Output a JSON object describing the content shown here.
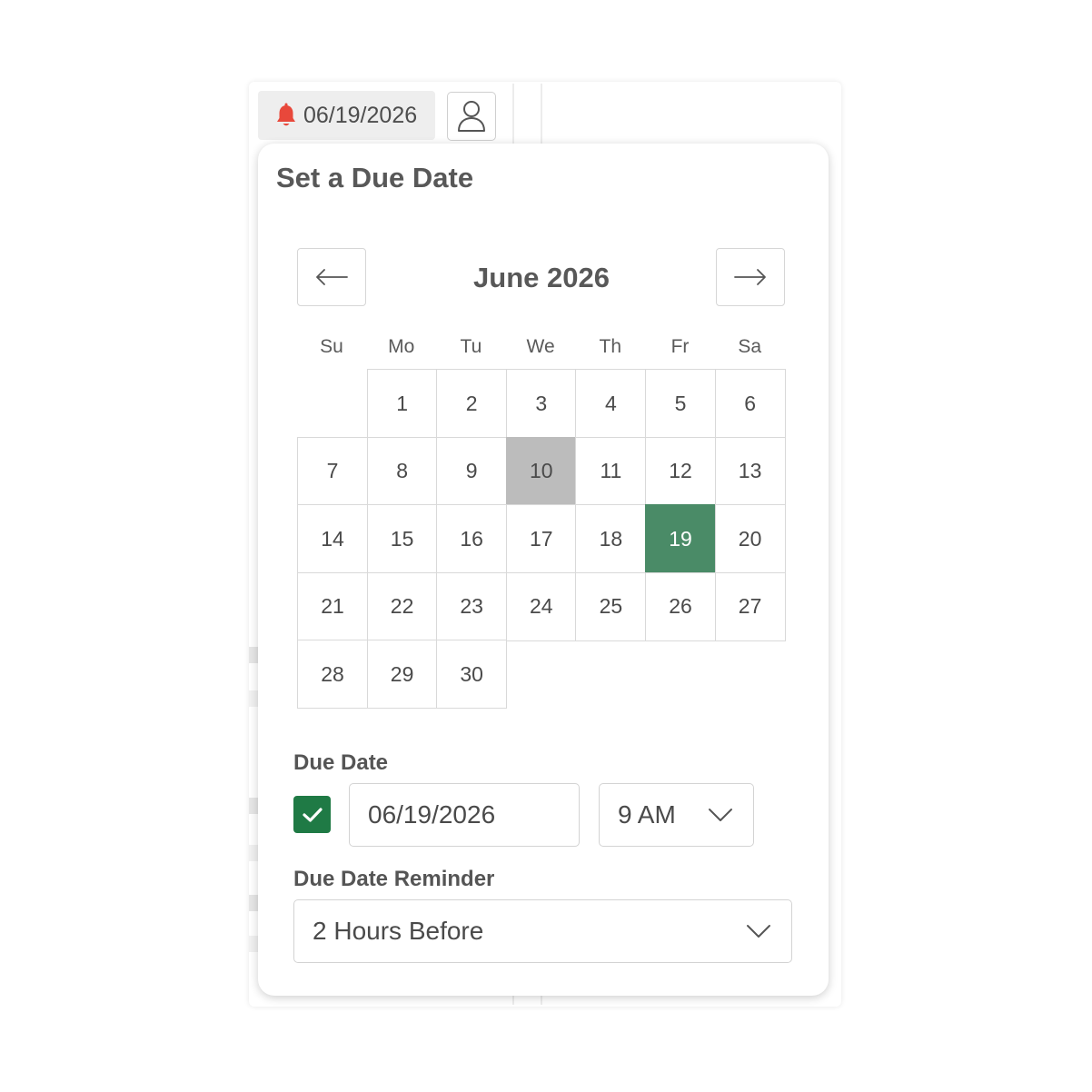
{
  "toolbar": {
    "due_chip_date": "06/19/2026",
    "bell_icon": "bell-icon",
    "assignee_icon": "person-icon"
  },
  "popover": {
    "title": "Set a Due Date",
    "calendar": {
      "month_label": "June 2026",
      "prev_icon": "arrow-left-icon",
      "next_icon": "arrow-right-icon",
      "weekdays": [
        "Su",
        "Mo",
        "Tu",
        "We",
        "Th",
        "Fr",
        "Sa"
      ],
      "leading_blank_days": 1,
      "days": [
        "1",
        "2",
        "3",
        "4",
        "5",
        "6",
        "7",
        "8",
        "9",
        "10",
        "11",
        "12",
        "13",
        "14",
        "15",
        "16",
        "17",
        "18",
        "19",
        "20",
        "21",
        "22",
        "23",
        "24",
        "25",
        "26",
        "27",
        "28",
        "29",
        "30"
      ],
      "today": "10",
      "selected": "19"
    },
    "due_date": {
      "label": "Due Date",
      "enabled": true,
      "date_value": "06/19/2026",
      "time_value": "9 AM"
    },
    "reminder": {
      "label": "Due Date Reminder",
      "value": "2 Hours Before"
    }
  },
  "colors": {
    "bell": "#e8483b",
    "selected_day": "#4a8b67",
    "today_day": "#bcbcbc",
    "checkbox": "#1f7a45"
  }
}
